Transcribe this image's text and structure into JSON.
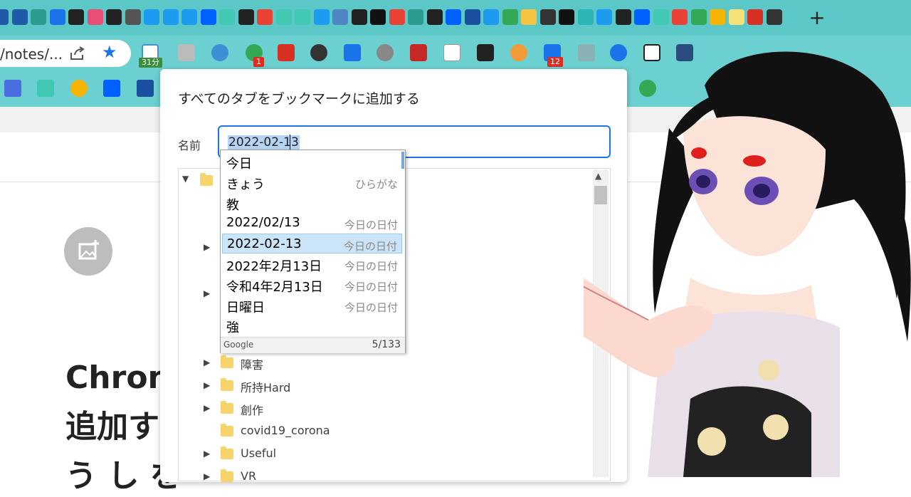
{
  "tabs": {
    "icons": [
      {
        "name": "tab-favicon-ship",
        "color": "#1e5aa8"
      },
      {
        "name": "tab-favicon-ship-2",
        "color": "#1e5aa8"
      },
      {
        "name": "tab-favicon-book",
        "color": "#2a9d8f"
      },
      {
        "name": "tab-favicon-lines",
        "color": "#1a73e8"
      },
      {
        "name": "tab-favicon-medium",
        "color": "#222222"
      },
      {
        "name": "tab-favicon-dots",
        "color": "#e94e77"
      },
      {
        "name": "tab-favicon-earth",
        "color": "#222222"
      },
      {
        "name": "tab-favicon-vr",
        "color": "#555555"
      },
      {
        "name": "tab-favicon-twitter",
        "color": "#1d9bf0"
      },
      {
        "name": "tab-favicon-twitter-2",
        "color": "#1d9bf0"
      },
      {
        "name": "tab-favicon-twitter-3",
        "color": "#1d9bf0"
      },
      {
        "name": "tab-favicon-dropbox",
        "color": "#0061fe"
      },
      {
        "name": "tab-favicon-note",
        "color": "#41c9b4"
      },
      {
        "name": "tab-favicon-monitor",
        "color": "#222222"
      },
      {
        "name": "tab-favicon-google",
        "color": "#ea4335"
      },
      {
        "name": "tab-favicon-note-2",
        "color": "#41c9b4"
      },
      {
        "name": "tab-favicon-note-3",
        "color": "#41c9b4"
      },
      {
        "name": "tab-favicon-twitter-4",
        "color": "#1d9bf0"
      },
      {
        "name": "tab-favicon-seven",
        "color": "#4f86c6"
      },
      {
        "name": "tab-favicon-earth-2",
        "color": "#222222"
      },
      {
        "name": "tab-favicon-barcode",
        "color": "#111111"
      },
      {
        "name": "tab-favicon-google-2",
        "color": "#ea4335"
      },
      {
        "name": "tab-favicon-rocket",
        "color": "#2a9d8f"
      },
      {
        "name": "tab-favicon-earth-3",
        "color": "#222222"
      },
      {
        "name": "tab-favicon-dropbox-2",
        "color": "#0061fe"
      },
      {
        "name": "tab-favicon-notion",
        "color": "#1a4fa0"
      },
      {
        "name": "tab-favicon-twitter-5",
        "color": "#1d9bf0"
      },
      {
        "name": "tab-favicon-play",
        "color": "#34a853"
      },
      {
        "name": "tab-favicon-character",
        "color": "#f5c542"
      },
      {
        "name": "tab-favicon-android",
        "color": "#333333"
      },
      {
        "name": "tab-favicon-z",
        "color": "#111111"
      },
      {
        "name": "tab-favicon-window",
        "color": "#2bb5b5"
      },
      {
        "name": "tab-favicon-twitter-6",
        "color": "#1d9bf0"
      },
      {
        "name": "tab-favicon-github",
        "color": "#222222"
      },
      {
        "name": "tab-favicon-dropbox-3",
        "color": "#0061fe"
      },
      {
        "name": "tab-favicon-note-4",
        "color": "#41c9b4"
      },
      {
        "name": "tab-favicon-google-3",
        "color": "#ea4335"
      },
      {
        "name": "tab-favicon-gmail",
        "color": "#34a853"
      },
      {
        "name": "tab-favicon-paint",
        "color": "#f4b400"
      },
      {
        "name": "tab-favicon-kotoba",
        "color": "#f7e27a"
      },
      {
        "name": "tab-favicon-red-logo",
        "color": "#d93025"
      },
      {
        "name": "tab-favicon-star",
        "color": "#333333"
      }
    ],
    "new_tab_glyph": "+"
  },
  "toolbar": {
    "url": "/notes/...",
    "calendar_badge": "31分",
    "badge_1": "1",
    "badge_12": "12"
  },
  "page": {
    "heading_lines": [
      "Chrom",
      "追加す",
      "う し を"
    ]
  },
  "dialog": {
    "title": "すべてのタブをブックマークに追加する",
    "name_label": "名前",
    "name_value": "2022-02-13",
    "folders": [
      {
        "label": "障害",
        "expandable": true
      },
      {
        "label": "所持Hard",
        "expandable": true
      },
      {
        "label": "創作",
        "expandable": true
      },
      {
        "label": "covid19_corona",
        "expandable": false
      },
      {
        "label": "Useful",
        "expandable": true
      },
      {
        "label": "VR",
        "expandable": true
      }
    ]
  },
  "ime": {
    "candidates": [
      {
        "text": "今日",
        "note": ""
      },
      {
        "text": "きょう",
        "note": "ひらがな"
      },
      {
        "text": "教",
        "note": ""
      },
      {
        "text": "2022/02/13",
        "note": "今日の日付"
      },
      {
        "text": "2022-02-13",
        "note": "今日の日付",
        "selected": true
      },
      {
        "text": "2022年2月13日",
        "note": "今日の日付"
      },
      {
        "text": "令和4年2月13日",
        "note": "今日の日付"
      },
      {
        "text": "日曜日",
        "note": "今日の日付"
      },
      {
        "text": "強",
        "note": ""
      }
    ],
    "footer_brand": "Google",
    "footer_count": "5/133"
  },
  "colors": {
    "tabstrip": "#5cc7c7",
    "toolbar": "#6ccfd0",
    "accent": "#1a73e8",
    "selection": "#cce4f7"
  }
}
